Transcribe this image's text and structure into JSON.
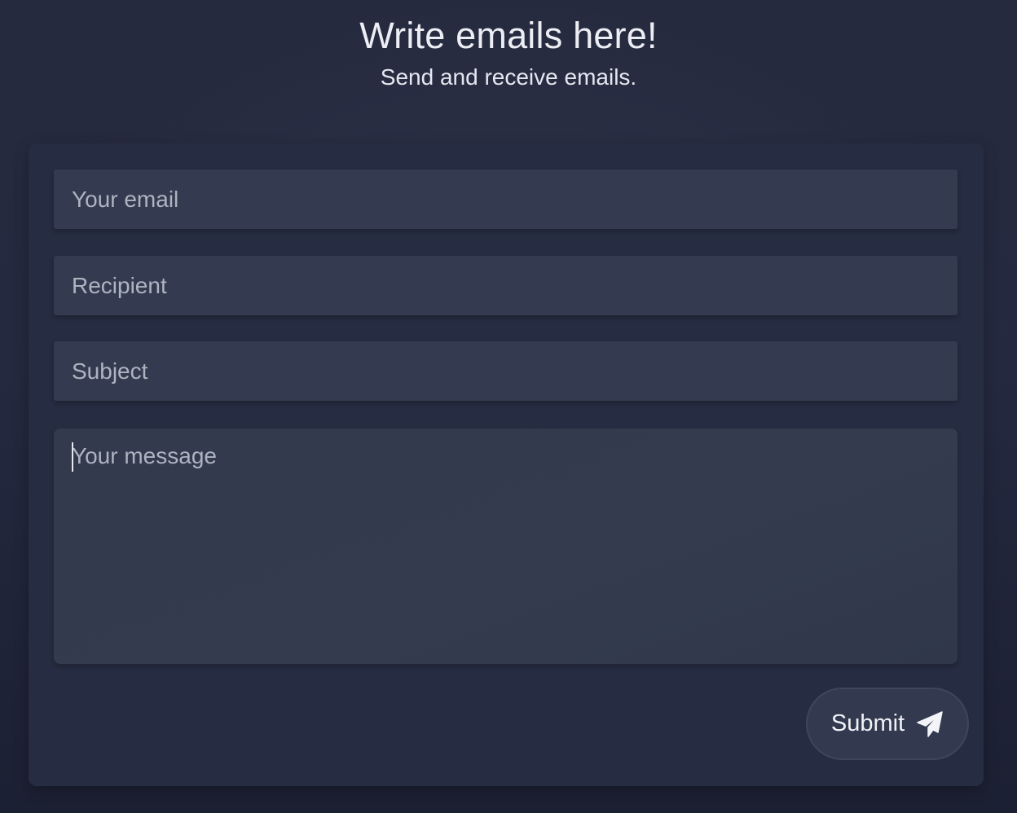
{
  "header": {
    "title": "Write emails here!",
    "subtitle": "Send and receive emails."
  },
  "form": {
    "email_placeholder": "Your email",
    "recipient_placeholder": "Recipient",
    "subject_placeholder": "Subject",
    "message_placeholder": "Your message",
    "submit_label": "Submit",
    "submit_icon": "paper-plane-icon"
  }
}
